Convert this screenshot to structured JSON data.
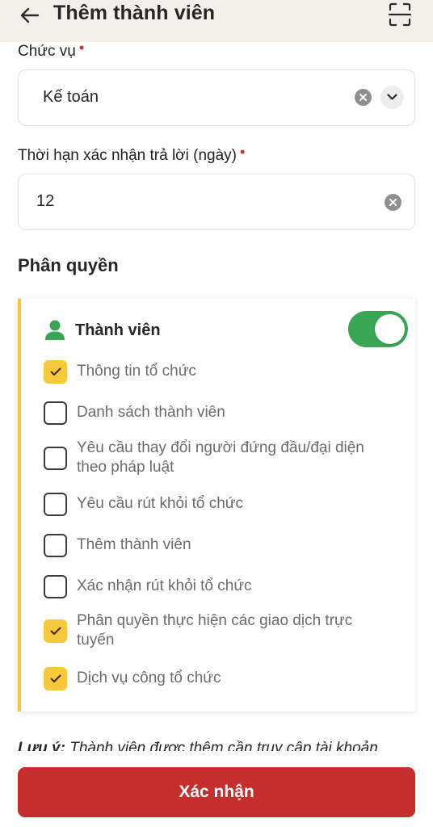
{
  "header": {
    "title": "Thêm thành viên",
    "back_icon": "arrow-left-icon",
    "scan_icon": "scan-icon"
  },
  "position_field": {
    "label": "Chức vụ",
    "required_mark": "•",
    "value": "Kế toán"
  },
  "deadline_field": {
    "label": "Thời hạn xác nhận trả lời (ngày)",
    "required_mark": "•",
    "value": "12"
  },
  "permissions": {
    "section_title": "Phân quyền",
    "group": {
      "title": "Thành viên",
      "icon": "user-icon",
      "enabled": true,
      "items": [
        {
          "label": "Thông tin tổ chức",
          "checked": true
        },
        {
          "label": "Danh sách thành viên",
          "checked": false
        },
        {
          "label_line1": "Yêu cầu thay đổi người đứng đầu/đại diện",
          "label_line2": "theo pháp luật",
          "checked": false
        },
        {
          "label": "Yêu cầu rút khỏi tổ chức",
          "checked": false
        },
        {
          "label": "Thêm thành viên",
          "checked": false
        },
        {
          "label": "Xác nhận rút khỏi tổ chức",
          "checked": false
        },
        {
          "label_line1": "Phân quyền thực hiện các giao dịch trực",
          "label_line2": "tuyến",
          "checked": true
        },
        {
          "label": "Dịch vụ công tổ chức",
          "checked": true
        }
      ]
    }
  },
  "note": {
    "prefix": "Lưu ý:",
    "text": "Thành viên được thêm cần truy cập tài khoản"
  },
  "confirm_button": {
    "label": "Xác nhận"
  },
  "colors": {
    "accent_red": "#c62e2e",
    "checkbox_yellow": "#f5c93b",
    "toggle_green": "#3aa655",
    "header_bg": "#f3f0ec"
  }
}
